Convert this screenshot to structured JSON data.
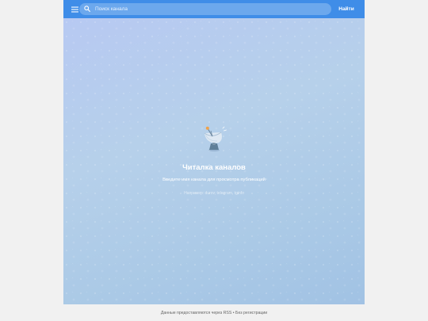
{
  "header": {
    "menu_icon": "hamburger-menu-icon",
    "search": {
      "icon": "search-icon",
      "placeholder": "Поиск канала",
      "value": ""
    },
    "find_label": "Найти"
  },
  "empty_state": {
    "icon": "satellite-dish-icon",
    "title": "Читалка каналов",
    "subtitle": "Введите имя канала для просмотра публикаций",
    "example": "Например: durov, telegram, tginfo"
  },
  "footer": {
    "text": "Данные предоставляются через RSS • Без регистрации"
  },
  "colors": {
    "topbar": "#3f8de8",
    "feed_gradient_start": "#b7c9f2",
    "feed_gradient_end": "#a1c2e4",
    "page_background": "#f1f1f1"
  }
}
